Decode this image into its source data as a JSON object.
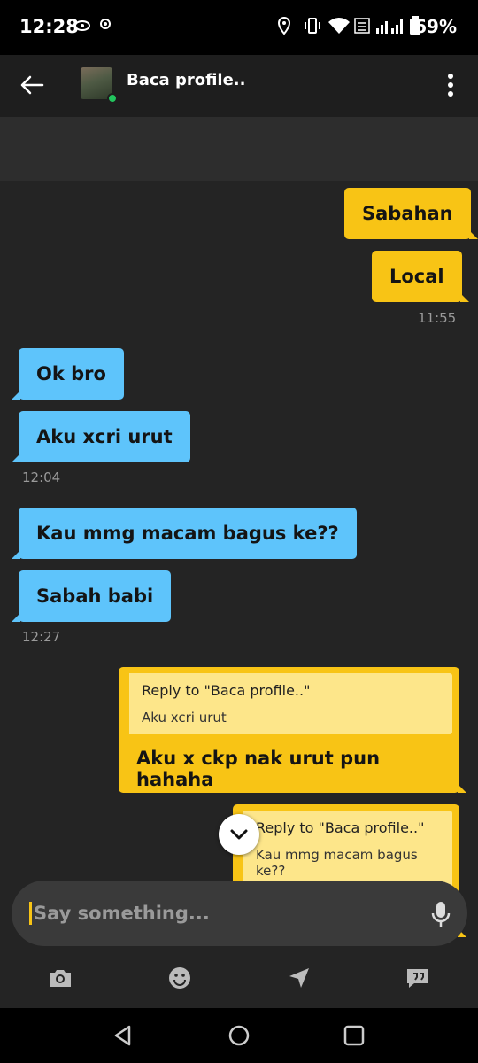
{
  "status_bar": {
    "time": "12:28",
    "battery": "69%"
  },
  "header": {
    "title": "Baca profile.."
  },
  "messages": [
    {
      "text": "Sabahan"
    },
    {
      "text": "Local"
    },
    {
      "text": "Ok bro"
    },
    {
      "text": "Aku xcri urut"
    },
    {
      "text": "Kau mmg macam bagus ke??"
    },
    {
      "text": "Sabah babi"
    },
    {
      "quote_header": "Reply to \"Baca profile..\"",
      "quote_text": "Aku xcri urut",
      "text": "Aku x ckp nak urut pun hahaha"
    },
    {
      "quote_header": "Reply to \"Baca profile..\"",
      "quote_text": "Kau mmg macam bagus ke??"
    }
  ],
  "timestamps": [
    "11:55",
    "12:04",
    "12:27"
  ],
  "input": {
    "placeholder": "Say something..."
  },
  "actions": [
    "camera-icon",
    "emoji-icon",
    "location-icon",
    "saved-phrases-icon"
  ],
  "colors": {
    "outgoing": "#f8c415",
    "incoming": "#5ec4fb",
    "background": "#242424"
  }
}
